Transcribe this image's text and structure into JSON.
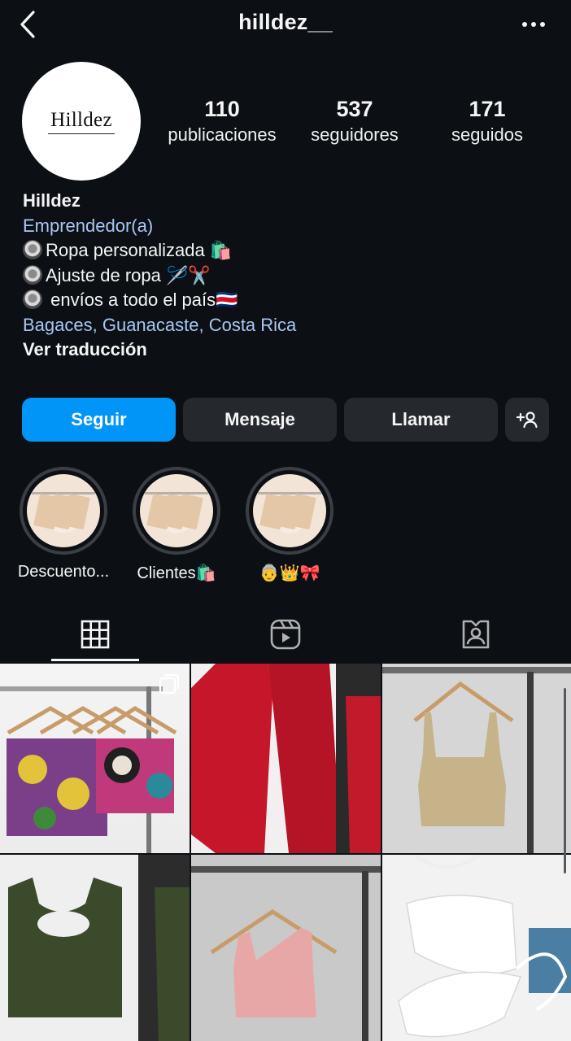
{
  "header": {
    "username": "hilldez__",
    "back_icon": "chevron-left-icon",
    "more_icon": "more-horizontal-icon"
  },
  "profile": {
    "avatar_text": "Hilldez",
    "stats": [
      {
        "value": "110",
        "label": "publicaciones"
      },
      {
        "value": "537",
        "label": "seguidores"
      },
      {
        "value": "171",
        "label": "seguidos"
      }
    ]
  },
  "bio": {
    "name": "Hilldez",
    "category": "Emprendedor(a)",
    "lines": [
      "Ropa personalizada 🛍️",
      "Ajuste de ropa 🪡✂️",
      " envíos a todo el país🇨🇷"
    ],
    "location": "Bagaces, Guanacaste, Costa Rica",
    "translate": "Ver traducción"
  },
  "actions": {
    "follow": "Seguir",
    "message": "Mensaje",
    "call": "Llamar",
    "add_icon": "add-person-icon"
  },
  "highlights": [
    {
      "label": "Descuento..."
    },
    {
      "label": "Clientes🛍️"
    },
    {
      "label": "👵👑🎀"
    }
  ],
  "tabs": [
    {
      "icon": "grid-icon"
    },
    {
      "icon": "reels-icon"
    },
    {
      "icon": "tagged-icon"
    }
  ],
  "colors": {
    "background": "#0c1014",
    "accent": "#0095f6",
    "link": "#a8c7f5",
    "button": "#25292e"
  }
}
